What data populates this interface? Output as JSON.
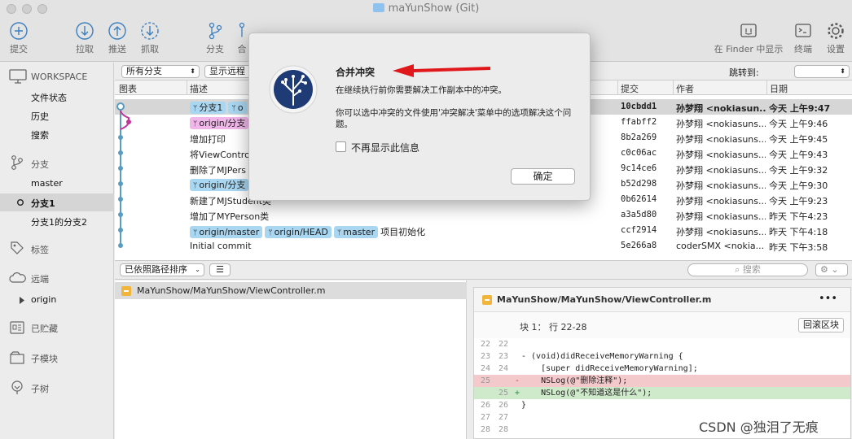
{
  "window": {
    "title": "maYunShow (Git)"
  },
  "toolbar": {
    "commit": "提交",
    "pull": "拉取",
    "push": "推送",
    "fetch": "抓取",
    "branch": "分支",
    "merge": "合",
    "show_in_finder": "在 Finder 中显示",
    "terminal": "终端",
    "settings": "设置"
  },
  "sidebar": {
    "workspace": "WORKSPACE",
    "workspace_items": [
      "文件状态",
      "历史",
      "搜索"
    ],
    "branches_header": "分支",
    "branches": [
      "master",
      "分支1",
      "分支1的分支2"
    ],
    "tags_header": "标签",
    "remotes_header": "远端",
    "remote_origin": "origin",
    "stash_header": "已贮藏",
    "submodules_header": "子模块",
    "subtrees_header": "子树"
  },
  "filterbar": {
    "all_branches": "所有分支",
    "show_remote": "显示远程",
    "jump_to": "跳转到:"
  },
  "columns": {
    "graph": "图表",
    "desc": "描述",
    "commit": "提交",
    "author": "作者",
    "date": "日期"
  },
  "commits": [
    {
      "tags": [
        "分支1",
        "o"
      ],
      "desc": "",
      "commit": "10cbdd1",
      "author": "孙梦翔 <nokiasun...",
      "date": "今天 上午9:47"
    },
    {
      "tags_pink": [
        "origin/分支"
      ],
      "desc": "",
      "commit": "ffabff2",
      "author": "孙梦翔 <nokiasuns...",
      "date": "今天 上午9:46"
    },
    {
      "desc": "增加打印",
      "commit": "8b2a269",
      "author": "孙梦翔 <nokiasuns...",
      "date": "今天 上午9:45"
    },
    {
      "desc": "将ViewContro",
      "commit": "c0c06ac",
      "author": "孙梦翔 <nokiasuns...",
      "date": "今天 上午9:43"
    },
    {
      "desc": "删除了MJPers",
      "commit": "9c14ce6",
      "author": "孙梦翔 <nokiasuns...",
      "date": "今天 上午9:32"
    },
    {
      "tags": [
        "origin/分支"
      ],
      "desc": "",
      "commit": "b52d298",
      "author": "孙梦翔 <nokiasuns...",
      "date": "今天 上午9:30"
    },
    {
      "desc": "新建了MJStudent类",
      "commit": "0b62614",
      "author": "孙梦翔 <nokiasuns...",
      "date": "今天 上午9:23"
    },
    {
      "desc": "增加了MYPerson类",
      "commit": "a3a5d80",
      "author": "孙梦翔 <nokiasuns...",
      "date": "昨天 下午4:23"
    },
    {
      "tags": [
        "origin/master",
        "origin/HEAD",
        "master"
      ],
      "desc": "项目初始化",
      "commit": "ccf2914",
      "author": "孙梦翔 <nokiasuns...",
      "date": "昨天 下午4:18"
    },
    {
      "desc": "Initial commit",
      "commit": "5e266a8",
      "author": "coderSMX <nokia...",
      "date": "昨天 下午3:58"
    }
  ],
  "lowbar": {
    "sort": "已依照路径排序",
    "search_placeholder": "搜索"
  },
  "file": {
    "path": "MaYunShow/MaYunShow/ViewController.m"
  },
  "diff": {
    "path": "MaYunShow/MaYunShow/ViewController.m",
    "more": "•••",
    "hunk_label": "块 1： 行 22-28",
    "rollback": "回滚区块",
    "lines": [
      {
        "o": "22",
        "n": "22",
        "s": "",
        "t": ""
      },
      {
        "o": "23",
        "n": "23",
        "s": "",
        "t": "- (void)didReceiveMemoryWarning {"
      },
      {
        "o": "24",
        "n": "24",
        "s": "",
        "t": "    [super didReceiveMemoryWarning];"
      },
      {
        "o": "25",
        "n": "",
        "s": "-",
        "t": "    NSLog(@\"删除注释\");"
      },
      {
        "o": "",
        "n": "25",
        "s": "+",
        "t": "    NSLog(@\"不知道这是什么\");"
      },
      {
        "o": "26",
        "n": "26",
        "s": "",
        "t": "}"
      },
      {
        "o": "27",
        "n": "27",
        "s": "",
        "t": ""
      },
      {
        "o": "28",
        "n": "28",
        "s": "",
        "t": ""
      }
    ]
  },
  "dialog": {
    "title": "合并冲突",
    "message1": "在继续执行前你需要解决工作副本中的冲突。",
    "message2": "你可以选中冲突的文件使用'冲突解决'菜单中的选项解决这个问题。",
    "checkbox": "不再显示此信息",
    "ok": "确定"
  },
  "watermark": "CSDN @独泪了无痕",
  "colors": {
    "tag_blue": "#a9d6f0",
    "tag_pink": "#f1b6ea",
    "arrow_red": "#e0181b",
    "graph_blue": "#5a9cc0",
    "graph_pink": "#c0369a"
  }
}
